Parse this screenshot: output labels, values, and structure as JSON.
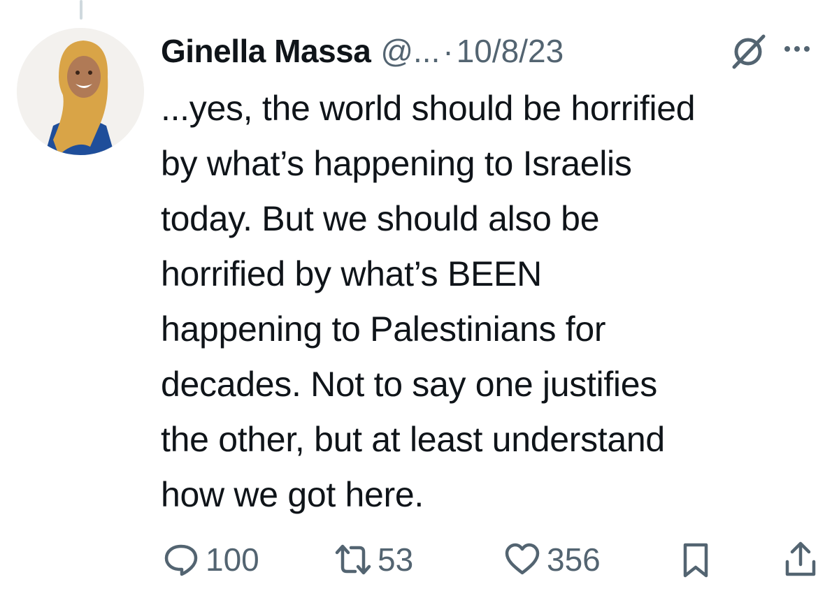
{
  "tweet": {
    "author_name": "Ginella Massa",
    "handle": "@...",
    "separator": "·",
    "date": "10/8/23",
    "text_lines": [
      "...yes, the world should be horrified",
      "by what’s happening to Israelis",
      "today. But we should also be",
      "horrified by what’s BEEN",
      "happening to Palestinians for",
      "decades. Not to say one justifies",
      "the other, but at least understand",
      "how we got here."
    ]
  },
  "actions": {
    "replies": "100",
    "reposts": "53",
    "likes": "356"
  },
  "icons": {
    "grok": "grok-icon",
    "more": "more-icon",
    "reply": "reply-icon",
    "repost": "repost-icon",
    "like": "heart-icon",
    "bookmark": "bookmark-icon",
    "share": "share-icon"
  },
  "colors": {
    "text": "#0f1419",
    "muted": "#536471",
    "thread_line": "#cfd9de",
    "hijab": "#d9a447",
    "blouse": "#1f4e9a"
  }
}
